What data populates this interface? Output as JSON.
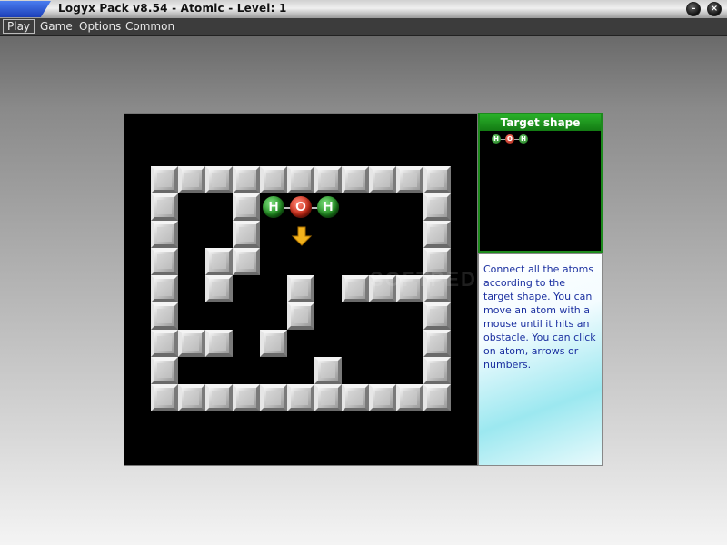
{
  "window": {
    "title": "Logyx Pack v8.54 - Atomic - Level: 1",
    "minimize_label": "–",
    "close_label": "×"
  },
  "menu": {
    "items": [
      "Play",
      "Game",
      "Options",
      "Common"
    ],
    "active": "Play"
  },
  "board": {
    "atoms": [
      {
        "symbol": "H",
        "element": "hydrogen"
      },
      {
        "symbol": "O",
        "element": "oxygen"
      },
      {
        "symbol": "H",
        "element": "hydrogen"
      }
    ],
    "selection_arrow": "arrow-down-icon",
    "watermark": "SOFTPEDIA"
  },
  "target": {
    "header": "Target shape",
    "atoms": [
      {
        "symbol": "H",
        "element": "hydrogen"
      },
      {
        "symbol": "O",
        "element": "oxygen"
      },
      {
        "symbol": "H",
        "element": "hydrogen"
      }
    ]
  },
  "help": {
    "text": "Connect all the atoms according to the target shape. You can move an atom with a mouse until it hits an obstacle. You can click on atom, arrows or numbers."
  },
  "colors": {
    "hydrogen": "#1e8a1e",
    "oxygen": "#c82814",
    "target_header": "#1d8a1d",
    "help_text": "#1a2fa0"
  }
}
